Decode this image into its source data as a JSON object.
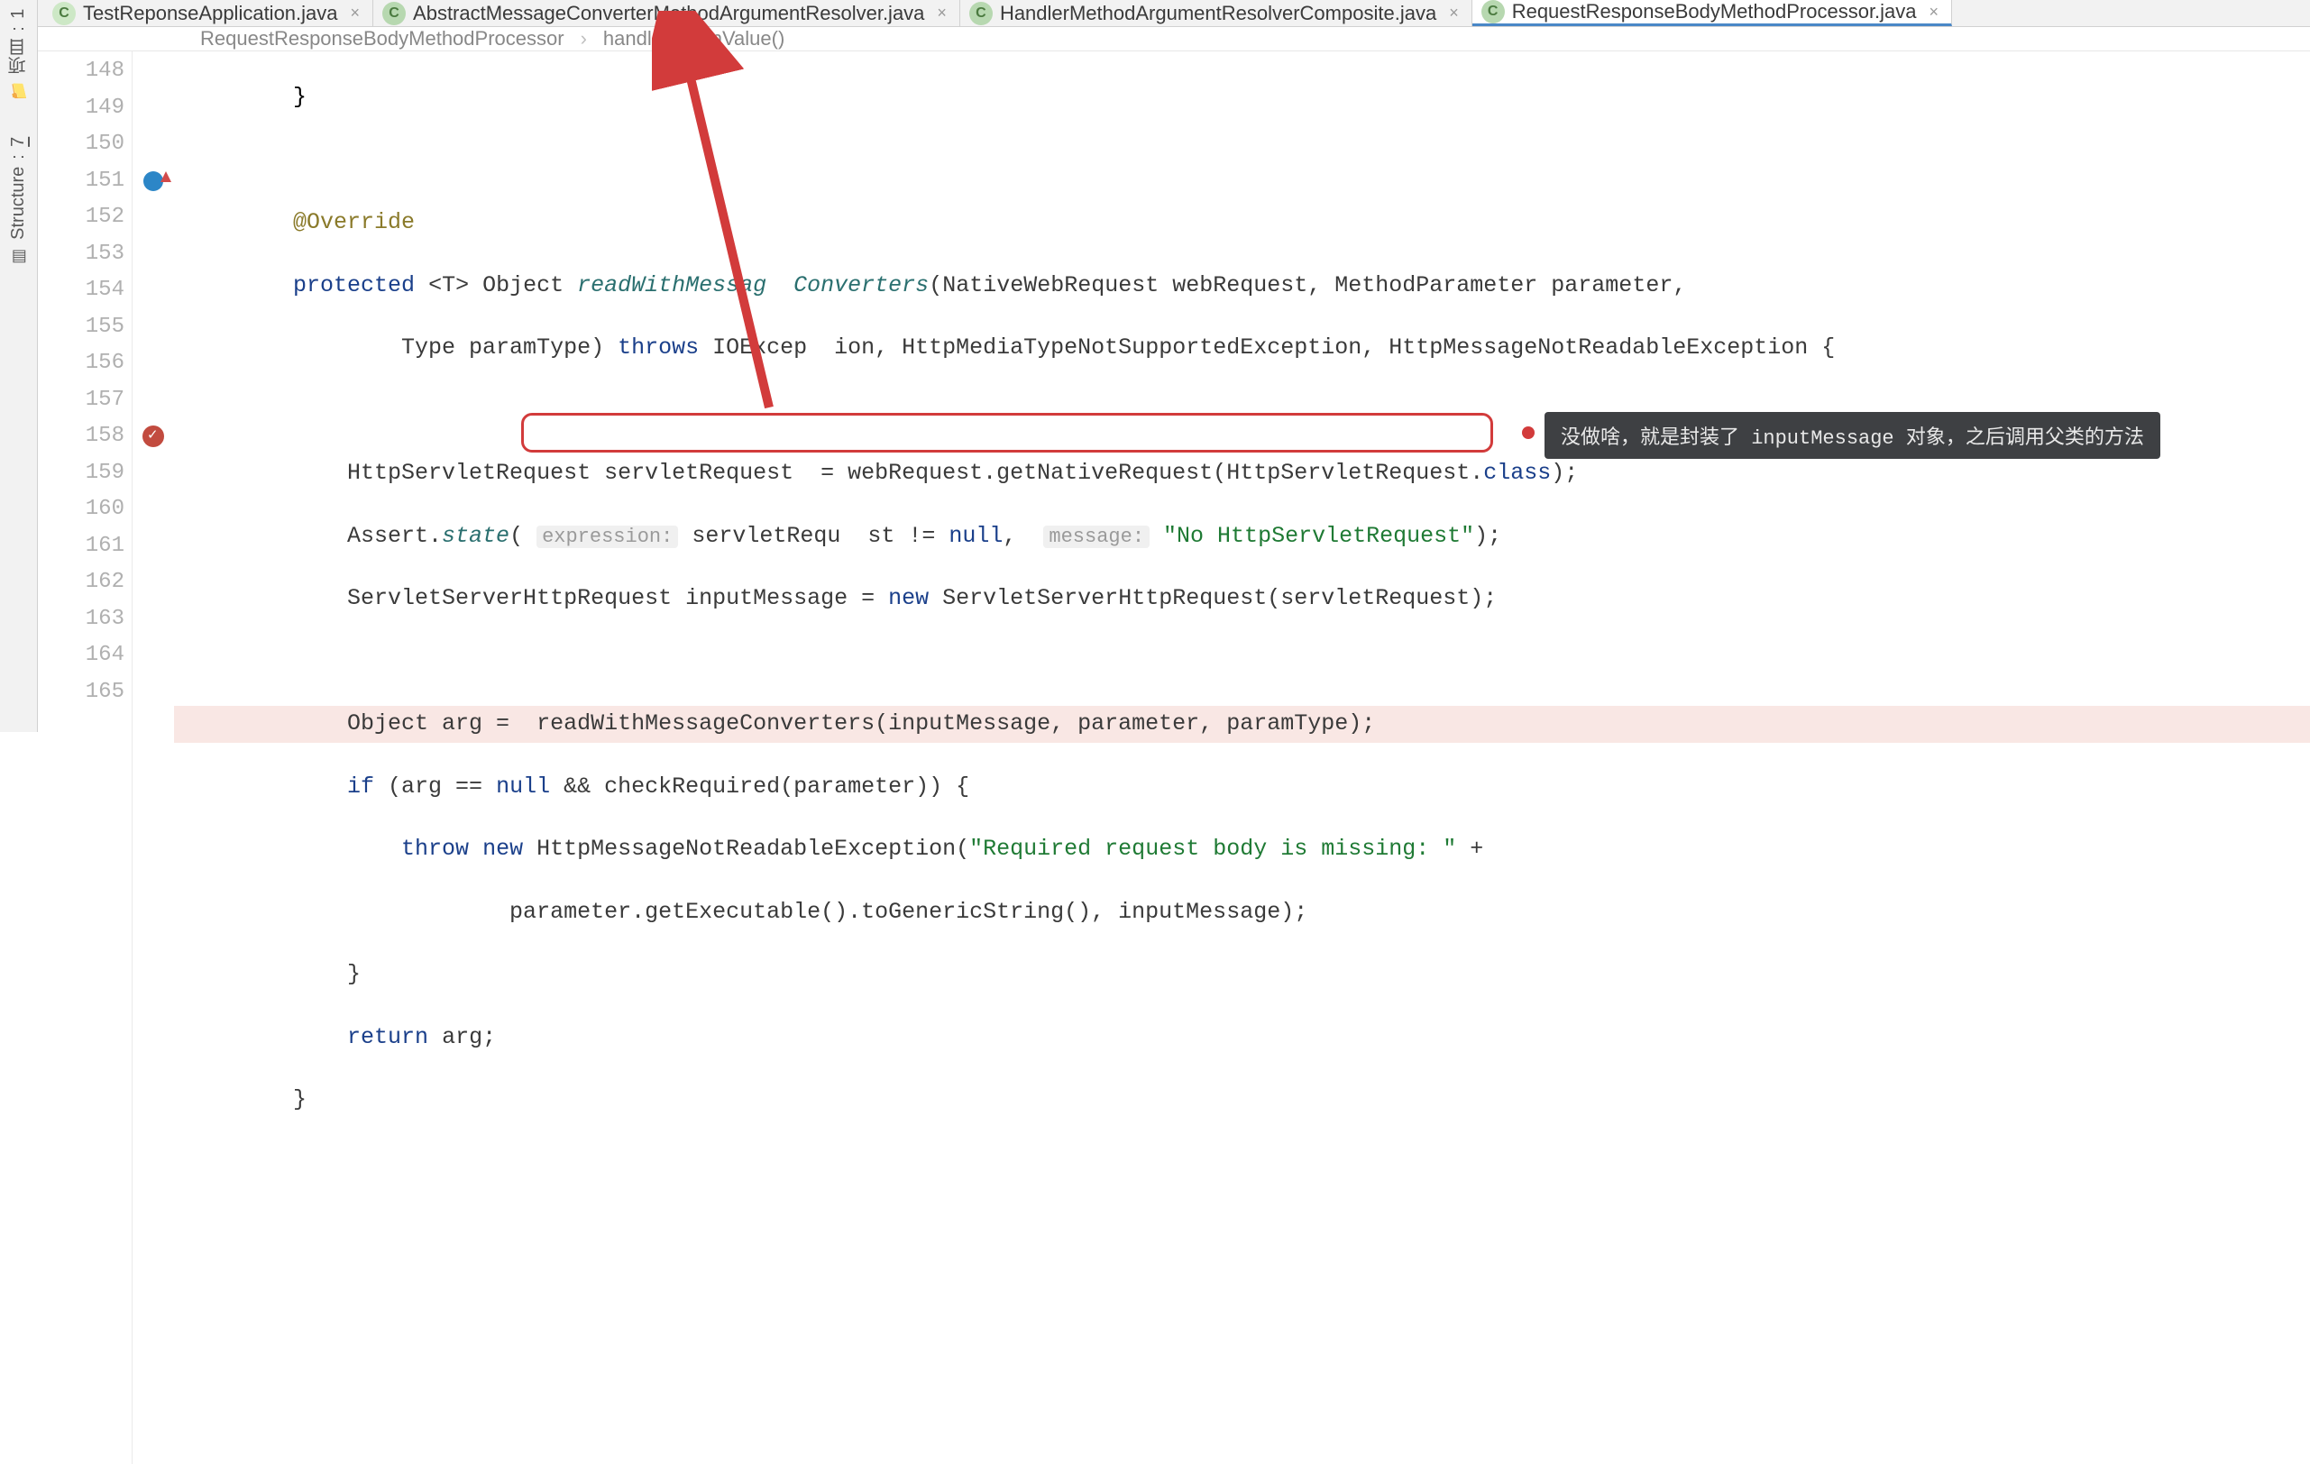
{
  "side_tabs": {
    "project": {
      "num": "1",
      "label": "项目"
    },
    "structure": {
      "num": "7",
      "label": "Structure"
    }
  },
  "tabs": [
    {
      "name": "TestReponseApplication.java",
      "active": false,
      "spring": true
    },
    {
      "name": "AbstractMessageConverterMethodArgumentResolver.java",
      "active": false,
      "spring": false
    },
    {
      "name": "HandlerMethodArgumentResolverComposite.java",
      "active": false,
      "spring": false
    },
    {
      "name": "RequestResponseBodyMethodProcessor.java",
      "active": true,
      "spring": false
    }
  ],
  "breadcrumb": {
    "a": "RequestResponseBodyMethodProcessor",
    "b": "handleReturnValue()"
  },
  "line_numbers": [
    "148",
    "149",
    "150",
    "151",
    "152",
    "153",
    "154",
    "155",
    "156",
    "157",
    "158",
    "159",
    "160",
    "161",
    "162",
    "163",
    "164",
    "165"
  ],
  "code": {
    "l148": "        }",
    "l150_ann": "@Override",
    "l151_kw1": "protected ",
    "l151_kw2": "<T> ",
    "l151_obj": "Object ",
    "l151_fn": "readWithMessag  Converters",
    "l151_rest": "(NativeWebRequest webRequest, MethodParameter parameter,",
    "l152_a": "                Type paramType) ",
    "l152_kw": "throws ",
    "l152_b": "IOExcep  ion, HttpMediaTypeNotSupportedException, HttpMessageNotReadableException {",
    "l154_a": "            HttpServletRequest servletRequest  = webRequest.getNativeRequest(HttpServletRequest.",
    "l154_kw": "class",
    "l154_b": ");",
    "l155_a": "            Assert.",
    "l155_fn": "state",
    "l155_b": "( ",
    "l155_h1": "expression:",
    "l155_c": " servletRequ  st != ",
    "l155_kw": "null",
    "l155_d": ",  ",
    "l155_h2": "message:",
    "l155_e": " ",
    "l155_str": "\"No HttpServletRequest\"",
    "l155_f": ");",
    "l156_a": "            ServletServerHttpRequest inputMessage = ",
    "l156_kw": "new ",
    "l156_b": "ServletServerHttpRequest(servletRequest);",
    "l158_a": "            Object arg = ",
    "l158_box": " readWithMessageConverters(inputMessage, parameter, paramType);",
    "l159_a": "            ",
    "l159_kw1": "if ",
    "l159_b": "(arg == ",
    "l159_kw2": "null ",
    "l159_c": "&& checkRequired(parameter)) {",
    "l160_a": "                ",
    "l160_kw1": "throw ",
    "l160_kw2": "new ",
    "l160_b": "HttpMessageNotReadableException(",
    "l160_str": "\"Required request body is missing: \"",
    "l160_c": " +",
    "l161": "                        parameter.getExecutable().toGenericString(), inputMessage);",
    "l162": "            }",
    "l163_a": "            ",
    "l163_kw": "return ",
    "l163_b": "arg;",
    "l164": "        }"
  },
  "callout_text": "没做啥，就是封装了 inputMessage 对象，之后调用父类的方法"
}
